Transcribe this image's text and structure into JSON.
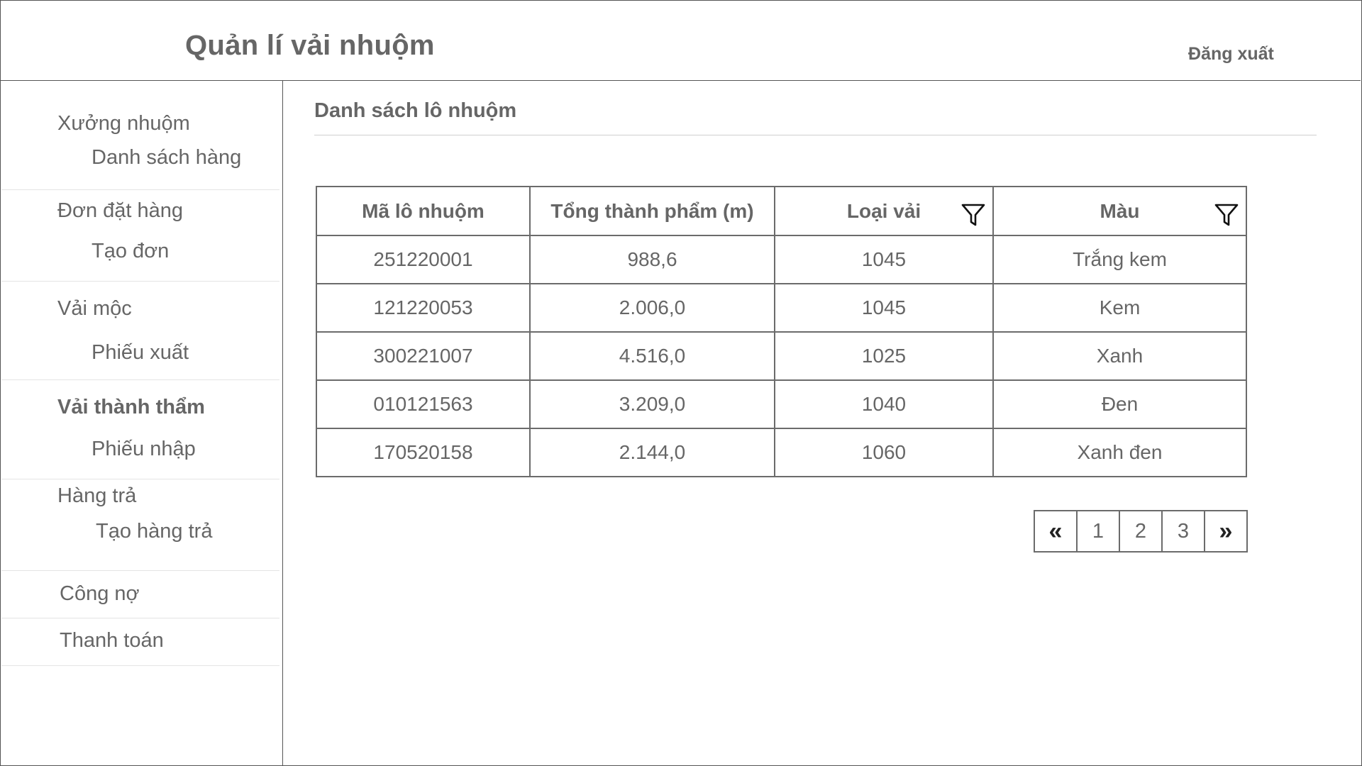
{
  "header": {
    "title": "Quản lí vải nhuộm",
    "logout_label": "Đăng xuất"
  },
  "sidebar": {
    "groups": [
      {
        "label": "Xưởng nhuộm",
        "sub": "Danh sách hàng",
        "active": false
      },
      {
        "label": "Đơn đặt hàng",
        "sub": "Tạo đơn",
        "active": false
      },
      {
        "label": "Vải mộc",
        "sub": "Phiếu xuất",
        "active": false
      },
      {
        "label": "Vải thành thẩm",
        "sub": "Phiếu nhập",
        "active": true
      },
      {
        "label": "Hàng trả",
        "sub": "Tạo hàng trả",
        "active": false
      },
      {
        "label": "Công nợ"
      },
      {
        "label": "Thanh toán"
      }
    ]
  },
  "main": {
    "section_title": "Danh sách lô nhuộm",
    "table": {
      "columns": [
        "Mã lô nhuộm",
        "Tổng thành phẩm (m)",
        "Loại vải",
        "Màu"
      ],
      "rows": [
        [
          "251220001",
          "988,6",
          "1045",
          "Trắng kem"
        ],
        [
          "121220053",
          "2.006,0",
          "1045",
          "Kem"
        ],
        [
          "300221007",
          "4.516,0",
          "1025",
          "Xanh"
        ],
        [
          "010121563",
          "3.209,0",
          "1040",
          "Đen"
        ],
        [
          "170520158",
          "2.144,0",
          "1060",
          "Xanh đen"
        ]
      ]
    },
    "pagination": {
      "prev": "«",
      "pages": [
        "1",
        "2",
        "3"
      ],
      "next": "»"
    }
  },
  "icons": {
    "filter": "filter-icon",
    "prev": "double-chevron-left-icon",
    "next": "double-chevron-right-icon"
  }
}
